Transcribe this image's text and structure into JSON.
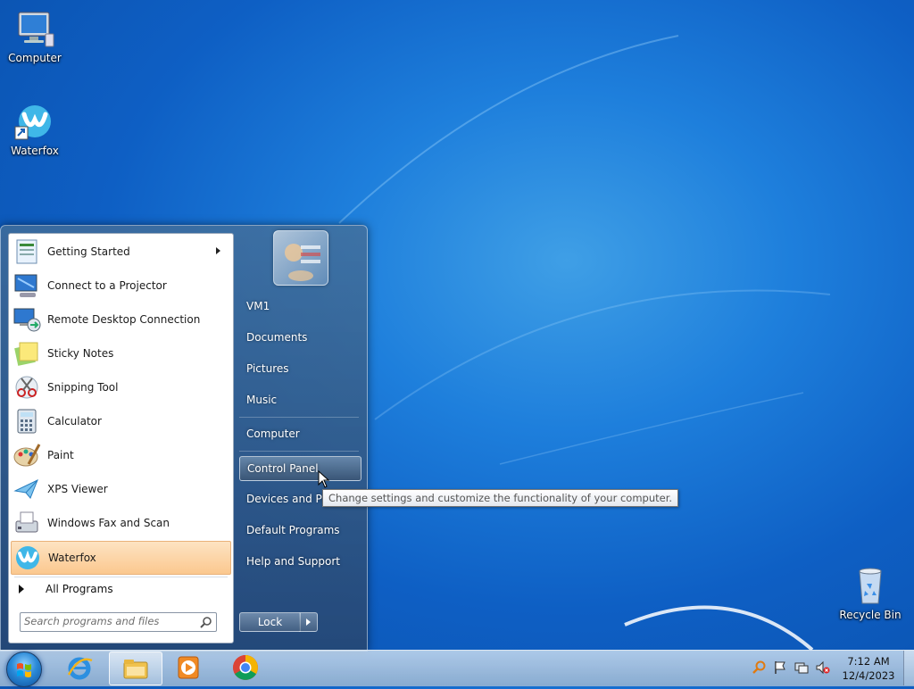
{
  "desktop": {
    "icons": [
      {
        "label": "Computer",
        "icon": "computer-icon"
      },
      {
        "label": "Waterfox",
        "icon": "waterfox-icon"
      },
      {
        "label": "Recycle Bin",
        "icon": "recycle-bin-icon"
      }
    ]
  },
  "start_menu": {
    "programs": [
      {
        "label": "Getting Started",
        "icon": "getting-started-icon",
        "has_submenu": true
      },
      {
        "label": "Connect to a Projector",
        "icon": "projector-icon"
      },
      {
        "label": "Remote Desktop Connection",
        "icon": "remote-desktop-icon"
      },
      {
        "label": "Sticky Notes",
        "icon": "sticky-notes-icon"
      },
      {
        "label": "Snipping Tool",
        "icon": "snipping-tool-icon"
      },
      {
        "label": "Calculator",
        "icon": "calculator-icon"
      },
      {
        "label": "Paint",
        "icon": "paint-icon"
      },
      {
        "label": "XPS Viewer",
        "icon": "xps-viewer-icon"
      },
      {
        "label": "Windows Fax and Scan",
        "icon": "fax-scan-icon"
      },
      {
        "label": "Waterfox",
        "icon": "waterfox-icon",
        "highlighted": true
      }
    ],
    "all_programs_label": "All Programs",
    "search_placeholder": "Search programs and files",
    "right_items": [
      {
        "label": "VM1"
      },
      {
        "label": "Documents"
      },
      {
        "label": "Pictures"
      },
      {
        "label": "Music"
      },
      {
        "label": "Computer"
      },
      {
        "label": "Control Panel",
        "highlighted": true
      },
      {
        "label": "Devices and Printers"
      },
      {
        "label": "Default Programs"
      },
      {
        "label": "Help and Support"
      }
    ],
    "lock_label": "Lock",
    "tooltip": "Change settings and customize the functionality of your computer."
  },
  "taskbar": {
    "buttons": [
      {
        "name": "internet-explorer-icon"
      },
      {
        "name": "windows-explorer-icon",
        "active": true
      },
      {
        "name": "media-player-icon"
      },
      {
        "name": "chrome-icon"
      }
    ],
    "clock_time": "7:12 AM",
    "clock_date": "12/4/2023"
  },
  "colors": {
    "desktop_blue": "#1e7fdc",
    "highlight_orange": "#fbc88f"
  }
}
